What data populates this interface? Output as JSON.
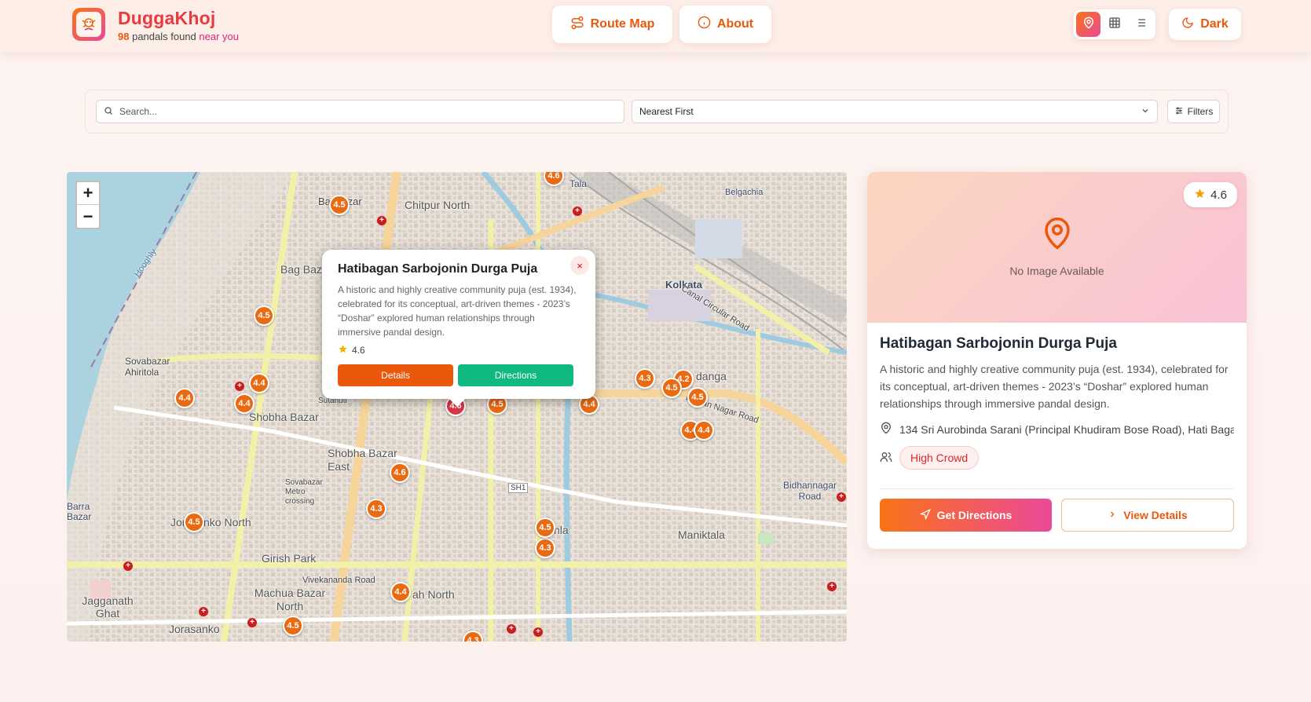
{
  "header": {
    "brand_title": "DuggaKhoj",
    "count": "98",
    "found_text": "pandals found",
    "near_text": "near you",
    "route_map_label": "Route Map",
    "about_label": "About",
    "dark_label": "Dark",
    "view_modes": [
      "map-pin-icon",
      "grid-icon",
      "list-icon"
    ],
    "active_view": "map"
  },
  "search": {
    "placeholder": "Search...",
    "sort_value": "Nearest First",
    "filters_label": "Filters"
  },
  "map": {
    "zoom_in": "+",
    "zoom_out": "−",
    "labels": {
      "chitpur_north": "Chitpur North",
      "bagbazar": "Bagbazar",
      "bag_baz": "Bag Baz",
      "sovabazar_ahiritola": "Sovabazar Ahiritola",
      "shobha_bazar": "Shobha Bazar",
      "shobha_bazar_east": "Shobha Bazar East",
      "jorasanko_north": "Jorasanko North",
      "girish_park": "Girish Park",
      "machua_bazar_north": "Machua Bazar North",
      "jagganath_ghat": "Jagganath Ghat",
      "jorasanko": "Jorasanko",
      "kolkata": "Kolkata",
      "belgachia": "Belgachia",
      "tala": "Tala",
      "maniktala": "Maniktala",
      "bidhannagar_road": "Bidhannagar Road",
      "barra_bazar": "Barra Bazar",
      "danga": "danga",
      "sovabazar_metro": "Sovabazar Metro crossing",
      "shyambazar_suf": "Sutanuti",
      "bidhan_nagar_road": "Bidhan Nagar Road",
      "canal_circular_road": "Canal Circular Road",
      "hooghly": "Hooghly",
      "vivekananda_road": "Vivekananda Road",
      "sh1": "SH1",
      "ah_north": "ah North",
      "nla": "nla"
    },
    "markers": [
      "4.5",
      "4.6",
      "4.5",
      "4.4",
      "4.4",
      "4.4",
      "4.6",
      "4.5",
      "4.4",
      "4.6",
      "4.3",
      "4.5",
      "4.3",
      "4.5",
      "4.4",
      "4.5",
      "4.3",
      "4.3",
      "4.2",
      "4.5",
      "4.5",
      "4.4",
      "4.4",
      "4.3"
    ],
    "popup": {
      "title": "Hatibagan Sarbojonin Durga Puja",
      "description": "A historic and highly creative community puja (est. 1934), celebrated for its conceptual, art-driven themes - 2023’s “Doshar” explored human relationships through immersive pandal design.",
      "rating": "4.6",
      "close": "×",
      "details_label": "Details",
      "directions_label": "Directions"
    }
  },
  "card": {
    "rating": "4.6",
    "no_image": "No Image Available",
    "title": "Hatibagan Sarbojonin Durga Puja",
    "description": "A historic and highly creative community puja (est. 1934), celebrated for its conceptual, art-driven themes - 2023’s “Doshar” explored human relationships through immersive pandal design.",
    "address": "134 Sri Aurobinda Sarani (Principal Khudiram Bose Road), Hati Baga...",
    "crowd": "High Crowd",
    "get_directions": "Get Directions",
    "view_details": "View Details"
  },
  "colors": {
    "brand_orange": "#ea580c",
    "brand_pink": "#ec4899",
    "marker": "#ea6a12",
    "directions_green": "#10b981",
    "crowd_red": "#dc2626"
  }
}
